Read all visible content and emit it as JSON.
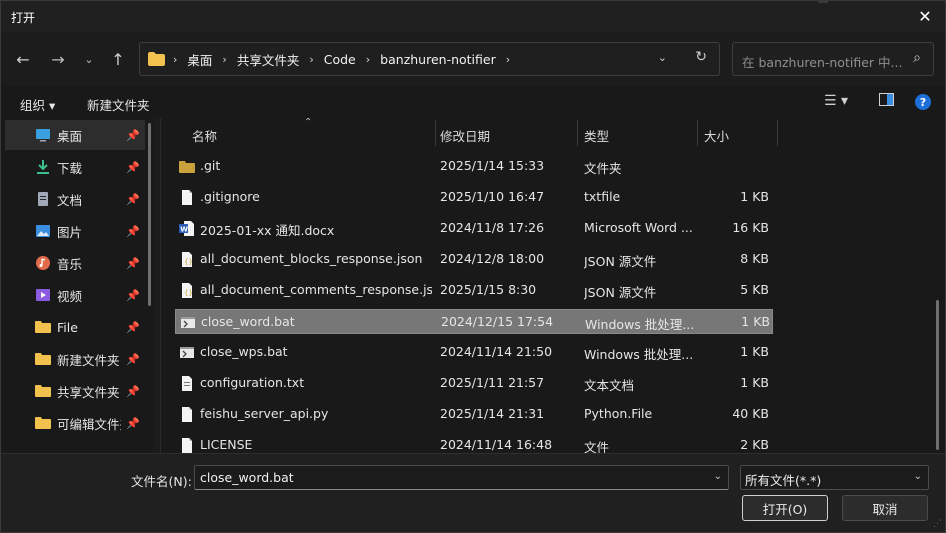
{
  "window": {
    "title": "打开"
  },
  "address": {
    "crumbs": [
      "桌面",
      "共享文件夹",
      "Code",
      "banzhuren-notifier"
    ]
  },
  "search": {
    "placeholder": "在 banzhuren-notifier 中..."
  },
  "commandbar": {
    "organize": "组织 ▾",
    "new_folder": "新建文件夹"
  },
  "sidebar": {
    "items": [
      {
        "label": "桌面",
        "icon": "desktop-icon",
        "color": "#3aa0e0"
      },
      {
        "label": "下载",
        "icon": "download-icon",
        "color": "#3cc08a"
      },
      {
        "label": "文档",
        "icon": "document-icon",
        "color": "#a0a8b8"
      },
      {
        "label": "图片",
        "icon": "picture-icon",
        "color": "#3a8ee0"
      },
      {
        "label": "音乐",
        "icon": "music-icon",
        "color": "#e06a4a"
      },
      {
        "label": "视频",
        "icon": "video-icon",
        "color": "#8a5ae0"
      },
      {
        "label": "File",
        "icon": "folder-icon",
        "color": "#f2c14e"
      },
      {
        "label": "新建文件夹",
        "icon": "folder-icon",
        "color": "#f2c14e"
      },
      {
        "label": "共享文件夹",
        "icon": "folder-icon",
        "color": "#f2c14e"
      },
      {
        "label": "可编辑文件夹",
        "icon": "folder-icon",
        "color": "#f2c14e"
      }
    ]
  },
  "columns": {
    "name": "名称",
    "date": "修改日期",
    "type": "类型",
    "size": "大小"
  },
  "files": [
    {
      "name": ".git",
      "date": "2025/1/14 15:33",
      "type": "文件夹",
      "size": "",
      "icon": "folder"
    },
    {
      "name": ".gitignore",
      "date": "2025/1/10 16:47",
      "type": "txtfile",
      "size": "1 KB",
      "icon": "file"
    },
    {
      "name": "2025-01-xx 通知.docx",
      "date": "2024/11/8 17:26",
      "type": "Microsoft Word ...",
      "size": "16 KB",
      "icon": "word"
    },
    {
      "name": "all_document_blocks_response.json",
      "date": "2024/12/8 18:00",
      "type": "JSON 源文件",
      "size": "8 KB",
      "icon": "json"
    },
    {
      "name": "all_document_comments_response.js...",
      "date": "2025/1/15 8:30",
      "type": "JSON 源文件",
      "size": "5 KB",
      "icon": "json"
    },
    {
      "name": "close_word.bat",
      "date": "2024/12/15 17:54",
      "type": "Windows 批处理...",
      "size": "1 KB",
      "icon": "bat"
    },
    {
      "name": "close_wps.bat",
      "date": "2024/11/14 21:50",
      "type": "Windows 批处理...",
      "size": "1 KB",
      "icon": "bat"
    },
    {
      "name": "configuration.txt",
      "date": "2025/1/11 21:57",
      "type": "文本文档",
      "size": "1 KB",
      "icon": "text"
    },
    {
      "name": "feishu_server_api.py",
      "date": "2025/1/14 21:31",
      "type": "Python.File",
      "size": "40 KB",
      "icon": "file"
    },
    {
      "name": "LICENSE",
      "date": "2024/11/14 16:48",
      "type": "文件",
      "size": "2 KB",
      "icon": "file"
    }
  ],
  "selected_index": 5,
  "footer": {
    "filename_label": "文件名(N):",
    "filename_value": "close_word.bat",
    "filetype_value": "所有文件(*.*)",
    "open_button": "打开(O)",
    "cancel_button": "取消"
  }
}
